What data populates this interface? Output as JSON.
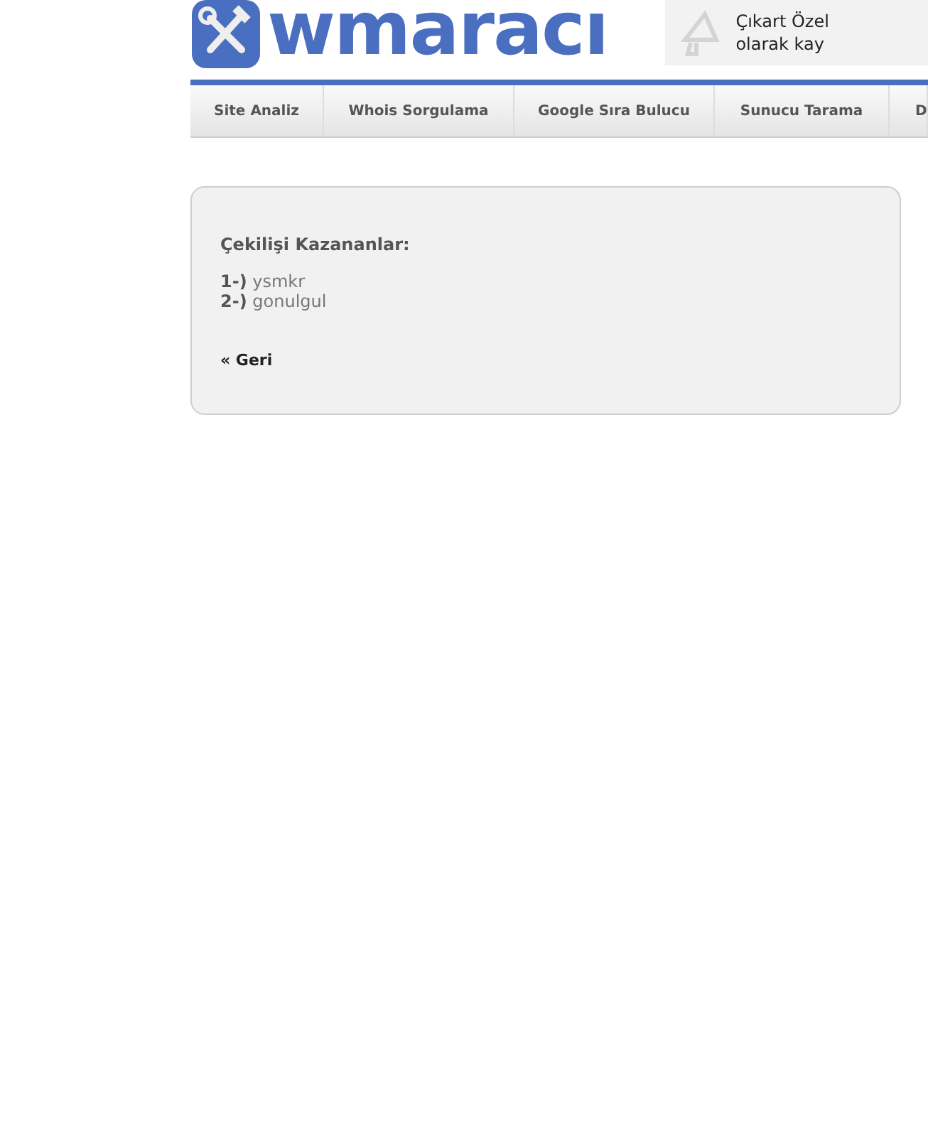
{
  "header": {
    "logo": "wmaracı",
    "promo": [
      "Çıkart Özel",
      "olarak kay"
    ]
  },
  "nav": [
    {
      "label": "Site Analiz"
    },
    {
      "label": "Whois Sorgulama"
    },
    {
      "label": "Google Sıra Bulucu"
    },
    {
      "label": "Sunucu Tarama"
    },
    {
      "label": "D"
    }
  ],
  "panel": {
    "heading": "Çekilişi Kazananlar:",
    "winners": [
      "**1-)** ysmkr",
      "**2-)** gonulgul"
    ],
    "back_link": "« Geri"
  }
}
